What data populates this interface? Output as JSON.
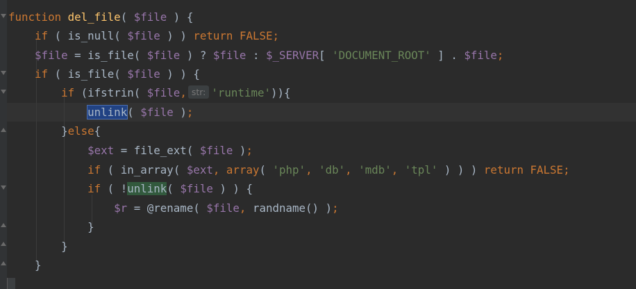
{
  "editor": {
    "tokens": {
      "kw_function": "function",
      "kw_if": "if",
      "kw_return": "return",
      "kw_else": "else",
      "kw_array": "array",
      "fn_del_file": "del_file",
      "is_null": "is_null",
      "is_file": "is_file",
      "ifstrin": "ifstrin",
      "unlink": "unlink",
      "file_ext": "file_ext",
      "in_array": "in_array",
      "rename": "@rename",
      "randname": "randname",
      "var_file": "$file",
      "var_server": "$_SERVER",
      "var_ext": "$ext",
      "var_r": "$r",
      "false": "FALSE",
      "str_document_root": "'DOCUMENT_ROOT'",
      "str_runtime": "'runtime'",
      "str_php": "'php'",
      "str_db": "'db'",
      "str_mdb": "'mdb'",
      "str_tpl": "'tpl'",
      "hint_str": "str:"
    }
  }
}
